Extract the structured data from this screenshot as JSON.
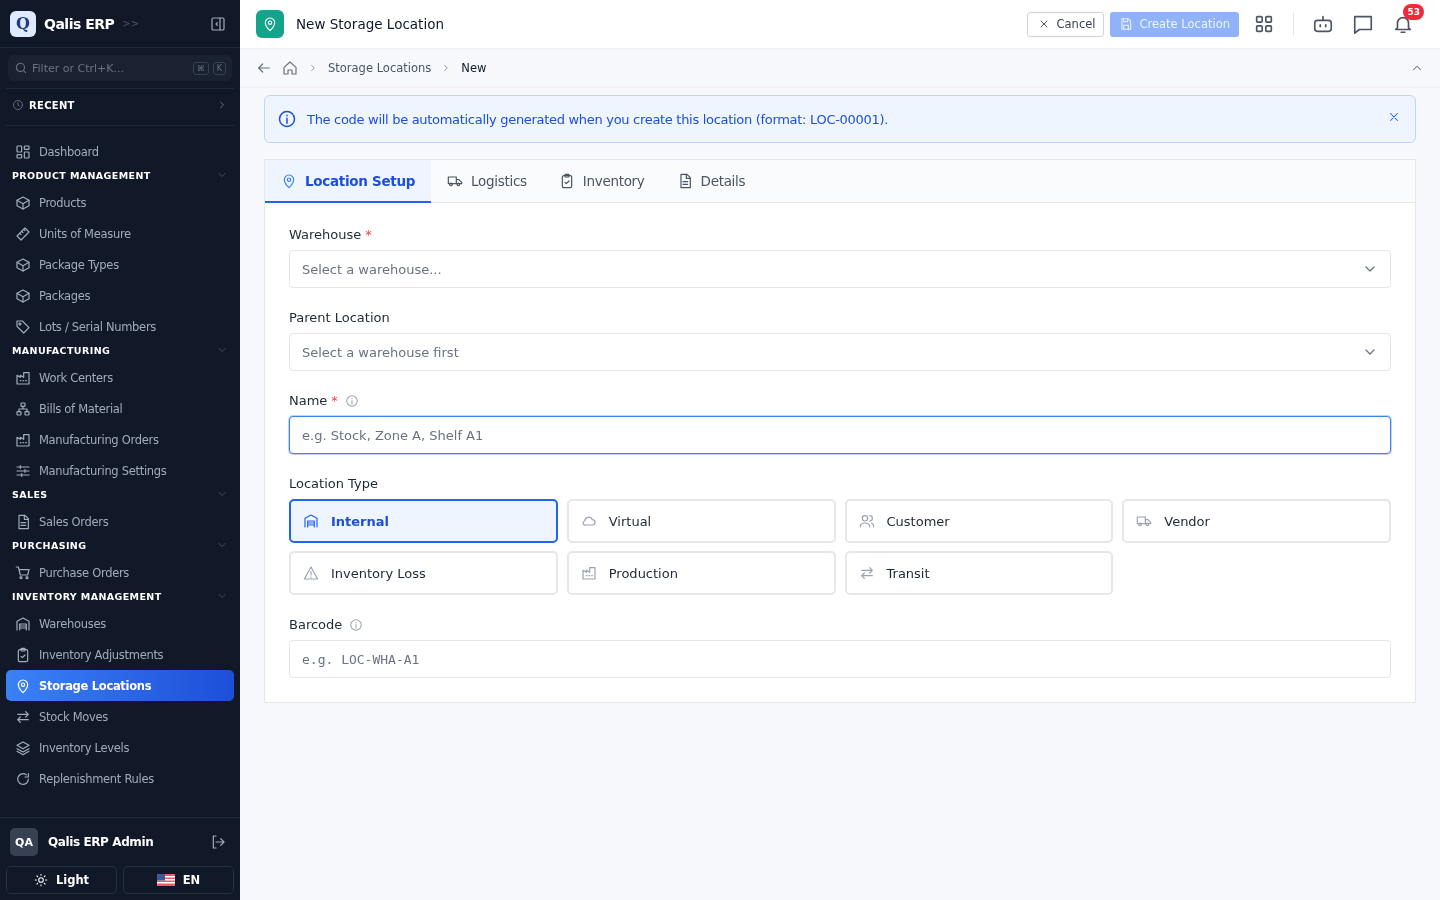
{
  "sidebar": {
    "brand": {
      "logo": "Q",
      "name": "Qalis ERP",
      "expand": ">>"
    },
    "search": {
      "placeholder": "Filter or Ctrl+K...",
      "keys": [
        "⌘",
        "K"
      ]
    },
    "recent": {
      "label": "RECENT",
      "expanded": false
    },
    "top_items": [
      {
        "label": "Dashboard",
        "selected": false
      }
    ],
    "sections": [
      {
        "title": "PRODUCT MANAGEMENT",
        "expanded": true,
        "items": [
          {
            "label": "Products",
            "selected": false
          },
          {
            "label": "Units of Measure",
            "selected": false
          },
          {
            "label": "Package Types",
            "selected": false
          },
          {
            "label": "Packages",
            "selected": false
          },
          {
            "label": "Lots / Serial Numbers",
            "selected": false
          }
        ]
      },
      {
        "title": "MANUFACTURING",
        "expanded": true,
        "items": [
          {
            "label": "Work Centers",
            "selected": false
          },
          {
            "label": "Bills of Material",
            "selected": false
          },
          {
            "label": "Manufacturing Orders",
            "selected": false
          },
          {
            "label": "Manufacturing Settings",
            "selected": false
          }
        ]
      },
      {
        "title": "SALES",
        "expanded": true,
        "items": [
          {
            "label": "Sales Orders",
            "selected": false
          }
        ]
      },
      {
        "title": "PURCHASING",
        "expanded": true,
        "items": [
          {
            "label": "Purchase Orders",
            "selected": false
          }
        ]
      },
      {
        "title": "INVENTORY MANAGEMENT",
        "expanded": true,
        "items": [
          {
            "label": "Warehouses",
            "selected": false
          },
          {
            "label": "Inventory Adjustments",
            "selected": false
          },
          {
            "label": "Storage Locations",
            "selected": true
          },
          {
            "label": "Stock Moves",
            "selected": false
          },
          {
            "label": "Inventory Levels",
            "selected": false
          },
          {
            "label": "Replenishment Rules",
            "selected": false
          }
        ]
      }
    ],
    "user": {
      "initials": "QA",
      "name": "Qalis ERP Admin"
    },
    "theme_button": "Light",
    "language_button": "EN"
  },
  "header": {
    "title": "New Storage Location",
    "cancel": "Cancel",
    "create": "Create Location",
    "create_disabled": true,
    "notification_count": "53"
  },
  "breadcrumb": [
    "Storage Locations",
    "New"
  ],
  "alert": {
    "text": "The code will be automatically generated when you create this location (format: LOC-00001)."
  },
  "tabs": [
    {
      "label": "Location Setup",
      "selected": true
    },
    {
      "label": "Logistics",
      "selected": false
    },
    {
      "label": "Inventory",
      "selected": false
    },
    {
      "label": "Details",
      "selected": false
    }
  ],
  "fields": [
    {
      "kind": "select",
      "label": "Warehouse",
      "required_mark": "*",
      "info": false,
      "placeholder": "Select a warehouse..."
    },
    {
      "kind": "select",
      "label": "Parent Location",
      "info": false,
      "placeholder": "Select a warehouse first"
    },
    {
      "kind": "text",
      "label": "Name",
      "required_mark": "*",
      "info": true,
      "focused": true,
      "placeholder": "e.g. Stock, Zone A, Shelf A1"
    },
    {
      "kind": "choices",
      "label": "Location Type",
      "info": false,
      "options": [
        {
          "label": "Internal",
          "selected": true
        },
        {
          "label": "Virtual",
          "selected": false
        },
        {
          "label": "Customer",
          "selected": false
        },
        {
          "label": "Vendor",
          "selected": false
        },
        {
          "label": "Inventory Loss",
          "selected": false
        },
        {
          "label": "Production",
          "selected": false
        },
        {
          "label": "Transit",
          "selected": false
        }
      ]
    },
    {
      "kind": "code",
      "label": "Barcode",
      "info": true,
      "focused": false,
      "placeholder": "e.g. LOC-WHA-A1"
    }
  ]
}
